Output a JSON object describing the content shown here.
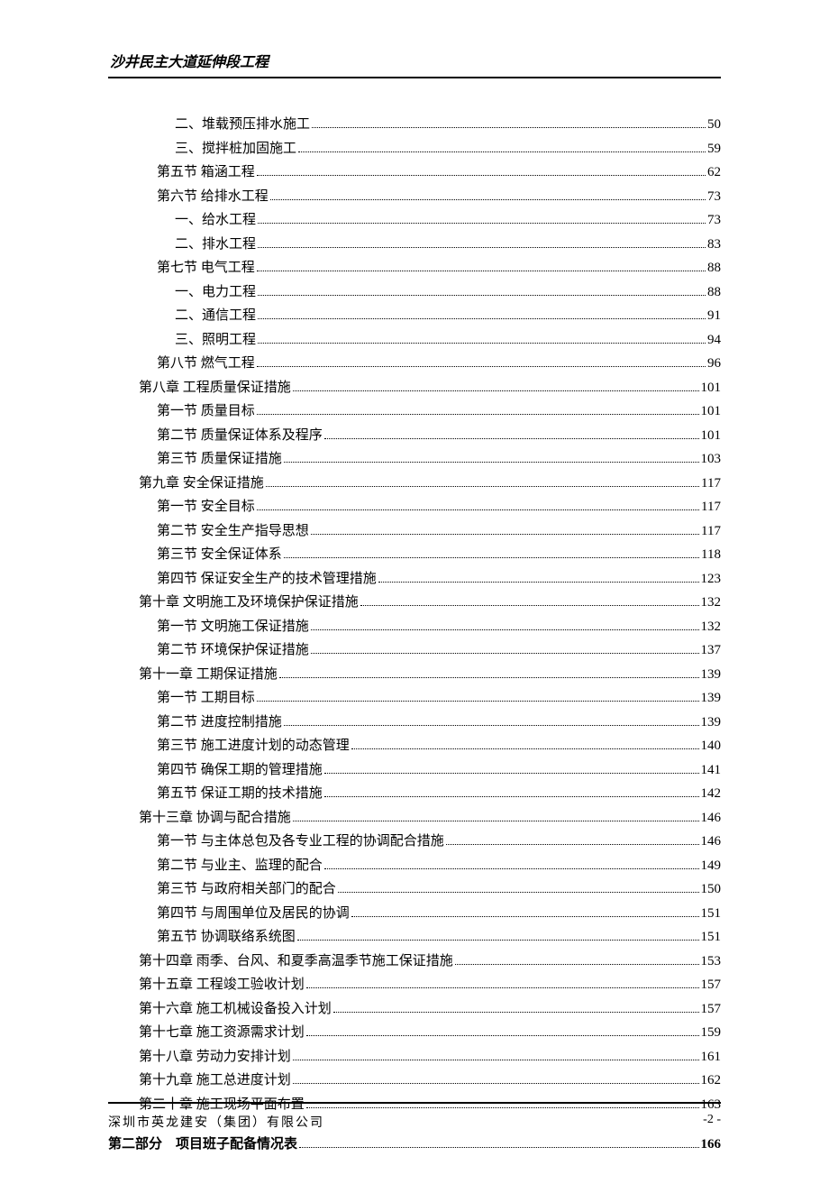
{
  "header": {
    "title": "沙井民主大道延伸段工程"
  },
  "toc": [
    {
      "level": 3,
      "title": "二、堆载预压排水施工",
      "page": "50"
    },
    {
      "level": 3,
      "title": "三、搅拌桩加固施工",
      "page": "59"
    },
    {
      "level": 2,
      "title": "第五节 箱涵工程",
      "page": "62"
    },
    {
      "level": 2,
      "title": "第六节 给排水工程",
      "page": "73"
    },
    {
      "level": 3,
      "title": "一、给水工程",
      "page": "73"
    },
    {
      "level": 3,
      "title": "二、排水工程",
      "page": "83"
    },
    {
      "level": 2,
      "title": "第七节 电气工程",
      "page": "88"
    },
    {
      "level": 3,
      "title": "一、电力工程",
      "page": "88"
    },
    {
      "level": 3,
      "title": "二、通信工程",
      "page": "91"
    },
    {
      "level": 3,
      "title": "三、照明工程",
      "page": "94"
    },
    {
      "level": 2,
      "title": "第八节 燃气工程",
      "page": "96"
    },
    {
      "level": 1,
      "title": "第八章 工程质量保证措施",
      "page": "101"
    },
    {
      "level": 2,
      "title": "第一节 质量目标",
      "page": "101"
    },
    {
      "level": 2,
      "title": "第二节 质量保证体系及程序",
      "page": "101"
    },
    {
      "level": 2,
      "title": "第三节 质量保证措施",
      "page": "103"
    },
    {
      "level": 1,
      "title": "第九章 安全保证措施",
      "page": "117"
    },
    {
      "level": 2,
      "title": "第一节 安全目标",
      "page": "117"
    },
    {
      "level": 2,
      "title": "第二节 安全生产指导思想",
      "page": "117"
    },
    {
      "level": 2,
      "title": "第三节 安全保证体系",
      "page": "118"
    },
    {
      "level": 2,
      "title": "第四节 保证安全生产的技术管理措施",
      "page": "123"
    },
    {
      "level": 1,
      "title": "第十章 文明施工及环境保护保证措施",
      "page": "132"
    },
    {
      "level": 2,
      "title": "第一节 文明施工保证措施",
      "page": "132"
    },
    {
      "level": 2,
      "title": "第二节 环境保护保证措施",
      "page": "137"
    },
    {
      "level": 1,
      "title": "第十一章 工期保证措施",
      "page": "139"
    },
    {
      "level": 2,
      "title": "第一节 工期目标",
      "page": "139"
    },
    {
      "level": 2,
      "title": "第二节 进度控制措施",
      "page": "139"
    },
    {
      "level": 2,
      "title": "第三节 施工进度计划的动态管理",
      "page": "140"
    },
    {
      "level": 2,
      "title": "第四节 确保工期的管理措施",
      "page": "141"
    },
    {
      "level": 2,
      "title": "第五节 保证工期的技术措施",
      "page": "142"
    },
    {
      "level": 1,
      "title": "第十三章 协调与配合措施",
      "page": "146"
    },
    {
      "level": 2,
      "title": "第一节 与主体总包及各专业工程的协调配合措施",
      "page": "146"
    },
    {
      "level": 2,
      "title": "第二节 与业主、监理的配合",
      "page": "149"
    },
    {
      "level": 2,
      "title": "第三节 与政府相关部门的配合",
      "page": "150"
    },
    {
      "level": 2,
      "title": "第四节 与周围单位及居民的协调",
      "page": "151"
    },
    {
      "level": 2,
      "title": "第五节 协调联络系统图",
      "page": "151"
    },
    {
      "level": 1,
      "title": "第十四章 雨季、台风、和夏季高温季节施工保证措施",
      "page": "153"
    },
    {
      "level": 1,
      "title": "第十五章 工程竣工验收计划",
      "page": "157"
    },
    {
      "level": 1,
      "title": "第十六章 施工机械设备投入计划",
      "page": "157"
    },
    {
      "level": 1,
      "title": "第十七章 施工资源需求计划",
      "page": "159"
    },
    {
      "level": 1,
      "title": "第十八章 劳动力安排计划",
      "page": "161"
    },
    {
      "level": 1,
      "title": "第十九章 施工总进度计划",
      "page": "162"
    },
    {
      "level": 1,
      "title": "第二十章 施工现场平面布置",
      "page": "163"
    },
    {
      "level": 0,
      "title": "第二部分　项目班子配备情况表",
      "page": "166",
      "part": true
    }
  ],
  "footer": {
    "company": "深圳市英龙建安（集团）有限公司",
    "page": "-2 -"
  }
}
